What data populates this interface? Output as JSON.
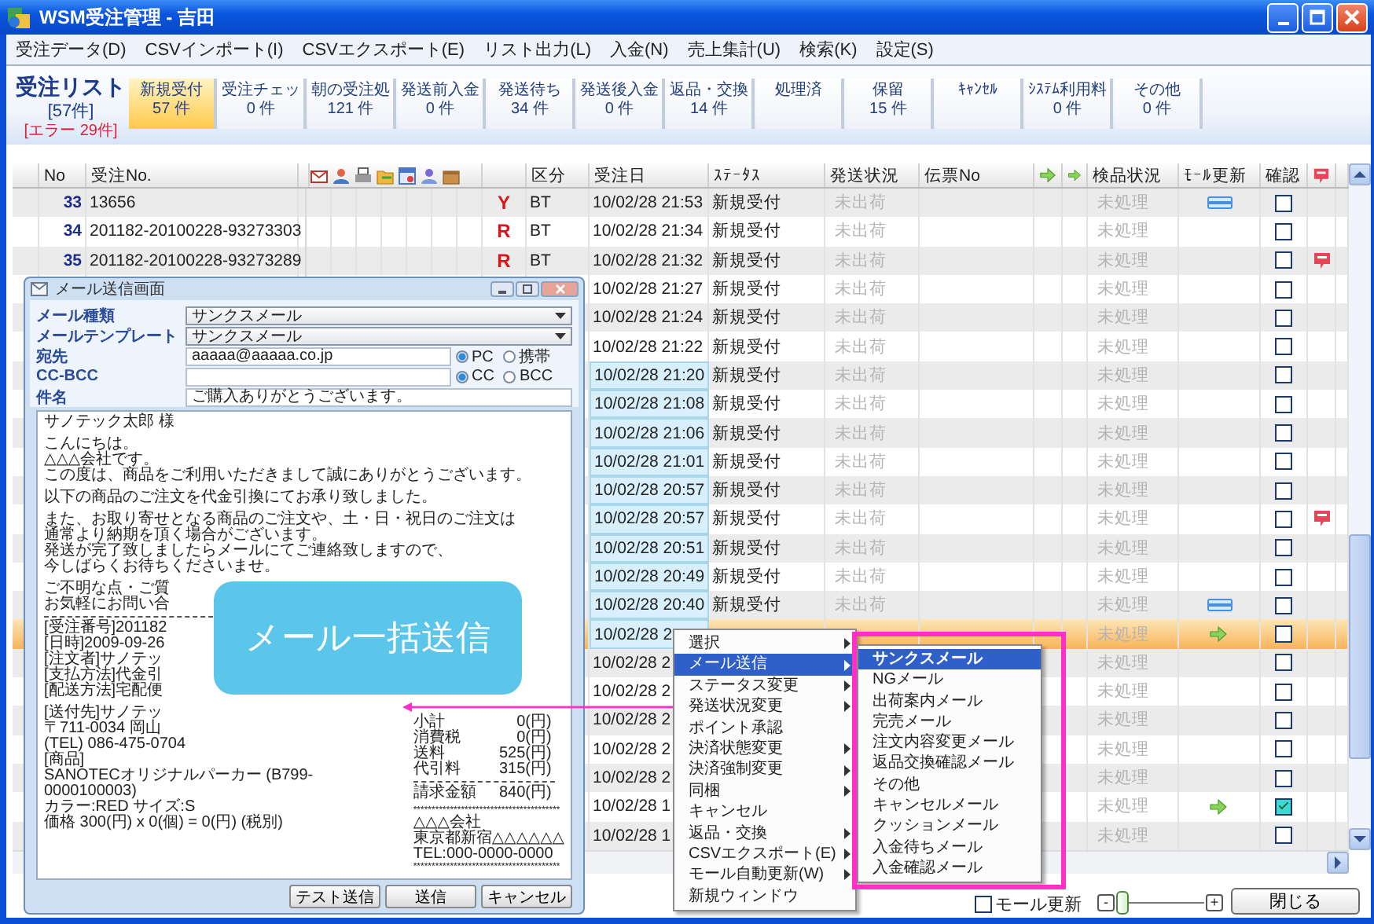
{
  "window": {
    "title": "WSM受注管理 - 吉田"
  },
  "menu": [
    "受注データ(D)",
    "CSVインポート(I)",
    "CSVエクスポート(E)",
    "リスト出力(L)",
    "入金(N)",
    "売上集計(U)",
    "検索(K)",
    "設定(S)"
  ],
  "list_header": {
    "title": "受注リスト",
    "count": "[57件]",
    "errors": "[エラー 29件]"
  },
  "status_tabs": [
    {
      "label": "新規受付",
      "count": "57 件",
      "selected": true
    },
    {
      "label": "受注チェッ",
      "count": "0 件",
      "selected": false
    },
    {
      "label": "朝の受注処",
      "count": "121 件",
      "selected": false
    },
    {
      "label": "発送前入金",
      "count": "0 件",
      "selected": false
    },
    {
      "label": "発送待ち",
      "count": "34 件",
      "selected": false
    },
    {
      "label": "発送後入金",
      "count": "0 件",
      "selected": false
    },
    {
      "label": "返品・交換",
      "count": "14 件",
      "selected": false
    },
    {
      "label": "処理済",
      "selected": false
    },
    {
      "label": "保留",
      "count": "15 件",
      "selected": false
    },
    {
      "label": "ｷｬﾝｾﾙ",
      "selected": false
    },
    {
      "label": "ｼｽﾃﾑ利用料",
      "count": "0 件",
      "selected": false
    },
    {
      "label": "その他",
      "count": "0 件",
      "selected": false
    }
  ],
  "table": {
    "columns": [
      "No",
      "受注No.",
      "区分",
      "受注日",
      "ｽﾃｰﾀｽ",
      "発送状況",
      "伝票No",
      "検品状況",
      "ﾓｰﾙ更新",
      "確認"
    ],
    "rows": [
      {
        "no": "33",
        "order_no": "13656",
        "mark": "Y",
        "kubun": "BT",
        "date": "10/02/28 21:53",
        "status": "新規受付",
        "shipping": "未出荷",
        "inspection": "未処理",
        "mall": {
          "kind": "card"
        },
        "confirmed": false,
        "flag": false,
        "selected": false,
        "focused": false
      },
      {
        "no": "34",
        "order_no": "201182-20100228-93273303",
        "mark": "R",
        "kubun": "BT",
        "date": "10/02/28 21:34",
        "status": "新規受付",
        "shipping": "未出荷",
        "inspection": "未処理",
        "confirmed": false,
        "flag": false,
        "selected": false,
        "focused": false
      },
      {
        "no": "35",
        "order_no": "201182-20100228-93273289",
        "mark": "R",
        "kubun": "BT",
        "date": "10/02/28 21:32",
        "status": "新規受付",
        "shipping": "未出荷",
        "inspection": "未処理",
        "confirmed": false,
        "flag": true,
        "selected": false,
        "focused": false
      },
      {
        "date": "10/02/28 21:27",
        "status": "新規受付",
        "shipping": "未出荷",
        "inspection": "未処理",
        "confirmed": false,
        "flag": false,
        "selected": false,
        "focused": false
      },
      {
        "date": "10/02/28 21:24",
        "status": "新規受付",
        "shipping": "未出荷",
        "inspection": "未処理",
        "confirmed": false,
        "flag": false,
        "selected": false,
        "focused": false
      },
      {
        "date": "10/02/28 21:22",
        "status": "新規受付",
        "shipping": "未出荷",
        "inspection": "未処理",
        "confirmed": false,
        "flag": false,
        "selected": false,
        "focused": false
      },
      {
        "date": "10/02/28 21:20",
        "status": "新規受付",
        "shipping": "未出荷",
        "inspection": "未処理",
        "confirmed": false,
        "flag": false,
        "selected": true,
        "focused": false
      },
      {
        "date": "10/02/28 21:08",
        "status": "新規受付",
        "shipping": "未出荷",
        "inspection": "未処理",
        "confirmed": false,
        "flag": false,
        "selected": true,
        "focused": false
      },
      {
        "date": "10/02/28 21:06",
        "status": "新規受付",
        "shipping": "未出荷",
        "inspection": "未処理",
        "confirmed": false,
        "flag": false,
        "selected": true,
        "focused": false
      },
      {
        "date": "10/02/28 21:01",
        "status": "新規受付",
        "shipping": "未出荷",
        "inspection": "未処理",
        "confirmed": false,
        "flag": false,
        "selected": true,
        "focused": false
      },
      {
        "date": "10/02/28 20:57",
        "status": "新規受付",
        "shipping": "未出荷",
        "inspection": "未処理",
        "confirmed": false,
        "flag": false,
        "selected": true,
        "focused": false
      },
      {
        "date": "10/02/28 20:57",
        "status": "新規受付",
        "shipping": "未出荷",
        "inspection": "未処理",
        "confirmed": false,
        "flag": true,
        "selected": true,
        "focused": false
      },
      {
        "date": "10/02/28 20:51",
        "status": "新規受付",
        "shipping": "未出荷",
        "inspection": "未処理",
        "confirmed": false,
        "flag": false,
        "selected": true,
        "focused": false
      },
      {
        "date": "10/02/28 20:49",
        "status": "新規受付",
        "shipping": "未出荷",
        "inspection": "未処理",
        "confirmed": false,
        "flag": false,
        "selected": true,
        "focused": false
      },
      {
        "date": "10/02/28 20:40",
        "status": "新規受付",
        "shipping": "未出荷",
        "inspection": "未処理",
        "mall": {
          "kind": "card"
        },
        "confirmed": false,
        "flag": false,
        "selected": true,
        "focused": false
      },
      {
        "date": "10/02/28 2",
        "inspection": "未処理",
        "mall": {
          "kind": "arrow"
        },
        "confirmed": false,
        "flag": false,
        "selected": true,
        "focused": true
      },
      {
        "date": "10/02/28 2",
        "inspection": "未処理",
        "confirmed": false,
        "flag": false,
        "selected": false,
        "focused": false
      },
      {
        "date": "10/02/28 2",
        "inspection": "未処理",
        "confirmed": false,
        "flag": false,
        "selected": false,
        "focused": false
      },
      {
        "date": "10/02/28 2",
        "inspection": "未処理",
        "confirmed": false,
        "flag": false,
        "selected": false,
        "focused": false
      },
      {
        "date": "10/02/28 2",
        "inspection": "未処理",
        "confirmed": false,
        "flag": false,
        "selected": false,
        "focused": false
      },
      {
        "date": "10/02/28 2",
        "inspection": "未処理",
        "confirmed": false,
        "flag": false,
        "selected": false,
        "focused": false
      },
      {
        "date": "10/02/28 1",
        "inspection": "未処理",
        "mall": {
          "kind": "arrow"
        },
        "confirmed": true,
        "flag": false,
        "selected": false,
        "focused": false
      },
      {
        "date": "10/02/28 1",
        "inspection": "未処理",
        "confirmed": false,
        "flag": false,
        "selected": false,
        "focused": false
      }
    ]
  },
  "bottom_bar": {
    "mall_update": {
      "label": "モール更新",
      "checked": false
    },
    "zoom": {
      "minus": "-",
      "plus": "+",
      "level": 0
    },
    "close_button": "閉じる"
  },
  "mail_dialog": {
    "title": "メール送信画面",
    "fields": [
      {
        "label": "メール種類",
        "kind": "combo",
        "value": "サンクスメール"
      },
      {
        "label": "メールテンプレート",
        "kind": "combo",
        "value": "サンクスメール"
      },
      {
        "label": "宛先",
        "kind": "input",
        "value": "aaaaa@aaaaa.co.jp",
        "options": [
          {
            "label": "PC",
            "selected": true
          },
          {
            "label": "携帯",
            "selected": false
          }
        ]
      },
      {
        "label": "CC-BCC",
        "kind": "input",
        "options": [
          {
            "label": "CC",
            "selected": true
          },
          {
            "label": "BCC",
            "selected": false
          }
        ]
      },
      {
        "label": "件名",
        "kind": "input",
        "value": "ご購入ありがとうございます。"
      }
    ],
    "body": {
      "intro": [
        [
          "サノテック太郎 様"
        ],
        [
          "こんにちは。",
          "△△△会社です。",
          "この度は、商品をご利用いただきまして誠にありがとうございます。"
        ],
        [
          "以下の商品のご注文を代金引換にてお承り致しました。"
        ],
        [
          "また、お取り寄せとなる商品のご注文や、土・日・祝日のご注文は",
          "通常より納期を頂く場合がございます。",
          "発送が完了致しましたらメールにてご連絡致しますので、",
          "今しばらくお待ちくださいませ。"
        ],
        [
          "ご不明な点・ご質",
          "お気軽にお問い合"
        ]
      ],
      "details": [
        [
          "[受注番号]201182",
          "[日時]2009-09-26",
          "[注文者]サノテッ",
          "[支払方法]代金引",
          "[配送方法]宅配便"
        ],
        [
          "[送付先]サノテッ",
          "〒711-0034 岡山",
          "(TEL) 086-475-0704",
          "[商品]",
          "SANOTECオリジナルパーカー (B799-0000100003)",
          "カラー:RED サイズ:S",
          "価格 300(円) x 0(個) = 0(円) (税別)"
        ]
      ],
      "totals": [
        [
          {
            "label": "小計",
            "value": "0(円)"
          },
          {
            "label": "消費税",
            "value": "0(円)"
          },
          {
            "label": "送料",
            "value": "525(円)"
          },
          {
            "label": "代引料",
            "value": "315(円)"
          }
        ],
        [
          {
            "label": "請求金額",
            "value": "840(円)"
          }
        ]
      ],
      "footer": [
        {
          "kind": "stars",
          "text": "****************************************"
        },
        {
          "kind": "line",
          "text": "△△△会社"
        },
        {
          "kind": "line",
          "text": "東京都新宿△△△△△△"
        },
        {
          "kind": "line",
          "text": "TEL:000-0000-0000"
        },
        {
          "kind": "stars",
          "text": "****************************************"
        }
      ]
    },
    "buttons": [
      "テスト送信",
      "送信",
      "キャンセル"
    ]
  },
  "callout": {
    "text": "メール一括送信"
  },
  "context_menu": {
    "items": [
      {
        "label": "選択",
        "submenu": true,
        "selected": false
      },
      {
        "label": "メール送信",
        "submenu": true,
        "selected": true
      },
      {
        "label": "ステータス変更",
        "submenu": true,
        "selected": false
      },
      {
        "label": "発送状況変更",
        "submenu": true,
        "selected": false
      },
      {
        "label": "ポイント承認",
        "submenu": false,
        "selected": false
      },
      {
        "label": "決済状態変更",
        "submenu": true,
        "selected": false
      },
      {
        "label": "決済強制変更",
        "submenu": true,
        "selected": false
      },
      {
        "label": "同梱",
        "submenu": true,
        "selected": false
      },
      {
        "label": "キャンセル",
        "submenu": false,
        "selected": false
      },
      {
        "label": "返品・交換",
        "submenu": true,
        "selected": false
      },
      {
        "label": "CSVエクスポート(E)",
        "submenu": true,
        "selected": false
      },
      {
        "label": "モール自動更新(W)",
        "submenu": true,
        "selected": false
      },
      {
        "label": "新規ウィンドウ",
        "submenu": false,
        "selected": false
      }
    ]
  },
  "submenu": {
    "items": [
      {
        "label": "サンクスメール",
        "selected": true
      },
      {
        "label": "NGメール",
        "selected": false
      },
      {
        "label": "出荷案内メール",
        "selected": false
      },
      {
        "label": "完売メール",
        "selected": false
      },
      {
        "label": "注文内容変更メール",
        "selected": false
      },
      {
        "label": "返品交換確認メール",
        "selected": false
      },
      {
        "label": "その他",
        "selected": false
      },
      {
        "label": "キャンセルメール",
        "selected": false
      },
      {
        "label": "クッションメール",
        "selected": false
      },
      {
        "label": "入金待ちメール",
        "selected": false
      },
      {
        "label": "入金確認メール",
        "selected": false
      }
    ]
  }
}
